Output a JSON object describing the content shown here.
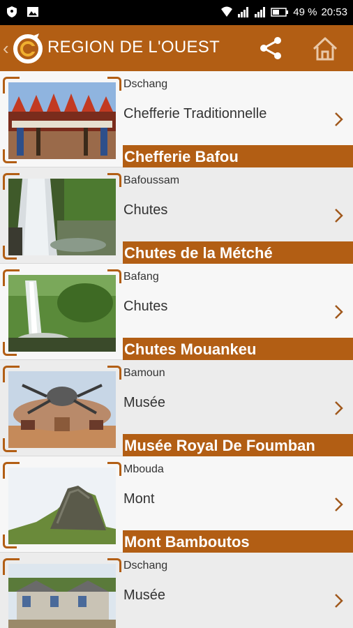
{
  "status_bar": {
    "battery": "49 %",
    "time": "20:53",
    "icons": [
      "shield-icon",
      "image-icon",
      "wifi-icon",
      "signal-icon",
      "signal-icon",
      "battery-icon"
    ]
  },
  "app_bar": {
    "title": "REGION DE L'OUEST",
    "icons": [
      "back-icon",
      "logo",
      "share-icon",
      "home-icon"
    ],
    "colors": {
      "primary": "#b25e14",
      "icon_tint": "#e9c8a8"
    }
  },
  "items": [
    {
      "city": "Dschang",
      "category": "Chefferie Traditionnelle",
      "title": "Chefferie Bafou",
      "thumb": "chefferie"
    },
    {
      "city": "Bafoussam",
      "category": "Chutes",
      "title": "Chutes de la Métché",
      "thumb": "waterfall1"
    },
    {
      "city": "Bafang",
      "category": "Chutes",
      "title": "Chutes Mouankeu",
      "thumb": "waterfall2"
    },
    {
      "city": "Bamoun",
      "category": "Musée",
      "title": "Musée Royal De Foumban",
      "thumb": "museum"
    },
    {
      "city": "Mbouda",
      "category": "Mont",
      "title": "Mont Bamboutos",
      "thumb": "mountain"
    },
    {
      "city": "Dschang",
      "category": "Musée",
      "title": "",
      "thumb": "museum2"
    }
  ]
}
